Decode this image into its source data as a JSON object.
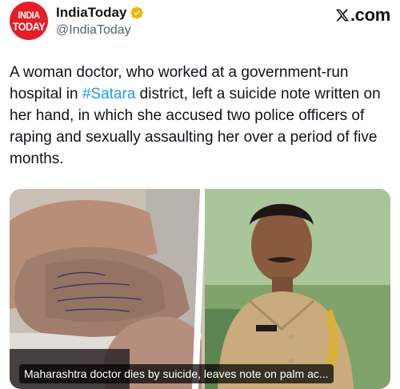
{
  "account": {
    "logo_line1": "INDIA",
    "logo_line2": "TODAY",
    "display_name": "IndiaToday",
    "handle": "@IndiaToday",
    "verified_icon": "gold-verified-badge"
  },
  "platform": {
    "logo_text": ".com",
    "logo_icon": "x-logo"
  },
  "tweet": {
    "text_before": "A woman doctor, who worked at a government-run hospital in ",
    "hashtag": "#Satara",
    "text_after": " district, left a suicide note written on her hand, in which she accused two police officers of raping and sexually assaulting her over a period of five months."
  },
  "media": {
    "caption": "Maharashtra doctor dies by suicide, leaves note on palm ac...",
    "images": [
      "hand-with-handwritten-note",
      "police-officer-portrait"
    ]
  },
  "colors": {
    "accent": "#1d9bf0",
    "brand": "#e31e26",
    "badge": "#f4b400"
  }
}
